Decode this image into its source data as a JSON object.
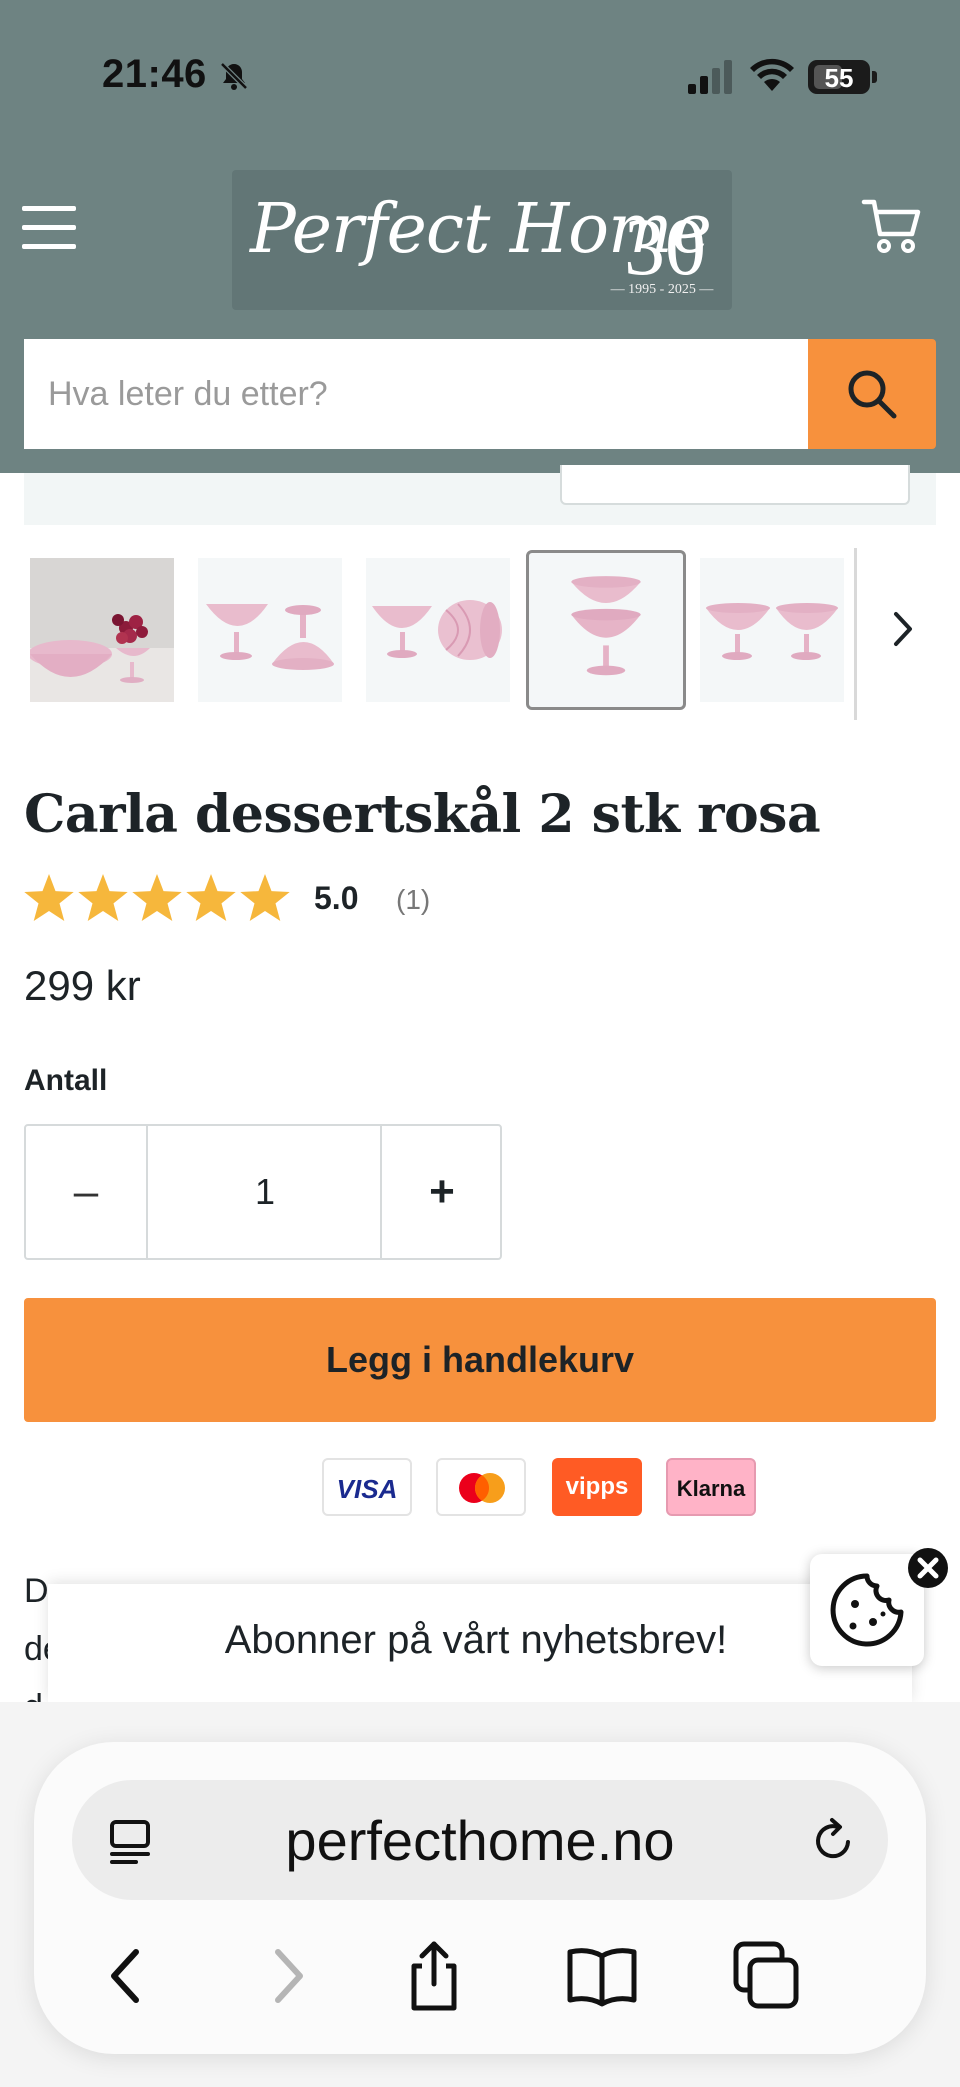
{
  "status_bar": {
    "time": "21:46",
    "battery": "55"
  },
  "header": {
    "logo": {
      "script": "Perfect Home",
      "number": "30",
      "years": "— 1995 - 2025 —"
    },
    "search_placeholder": "Hva leter du etter?"
  },
  "gallery": {
    "thumbnails": [
      {
        "alt": "Carla dessertskål rosa med druer"
      },
      {
        "alt": "Carla dessertskål rosa to skåler"
      },
      {
        "alt": "Carla dessertskål rosa liggende"
      },
      {
        "alt": "Carla dessertskål rosa stablet"
      },
      {
        "alt": "Carla dessertskål rosa side om side"
      }
    ],
    "active_index": 3
  },
  "product": {
    "title": "Carla dessertskål 2 stk rosa",
    "rating_value": "5.0",
    "rating_count": "(1)",
    "rating_stars": 5,
    "price": "299 kr",
    "quantity_label": "Antall",
    "quantity": "1",
    "minus": "–",
    "plus": "+",
    "add_to_cart": "Legg i handlekurv"
  },
  "payments": {
    "visa": "VISA",
    "vipps": "vipps",
    "klarna": "Klarna"
  },
  "description": {
    "line1": "D",
    "line2": "de",
    "line3": "d"
  },
  "newsletter": {
    "text": "Abonner på vårt nyhetsbrev!"
  },
  "browser": {
    "url": "perfecthome.no"
  },
  "colors": {
    "header_bg": "#6e8382",
    "accent_orange": "#f7913d",
    "star_color": "#f6b73c",
    "text_dark": "#1d2327"
  }
}
